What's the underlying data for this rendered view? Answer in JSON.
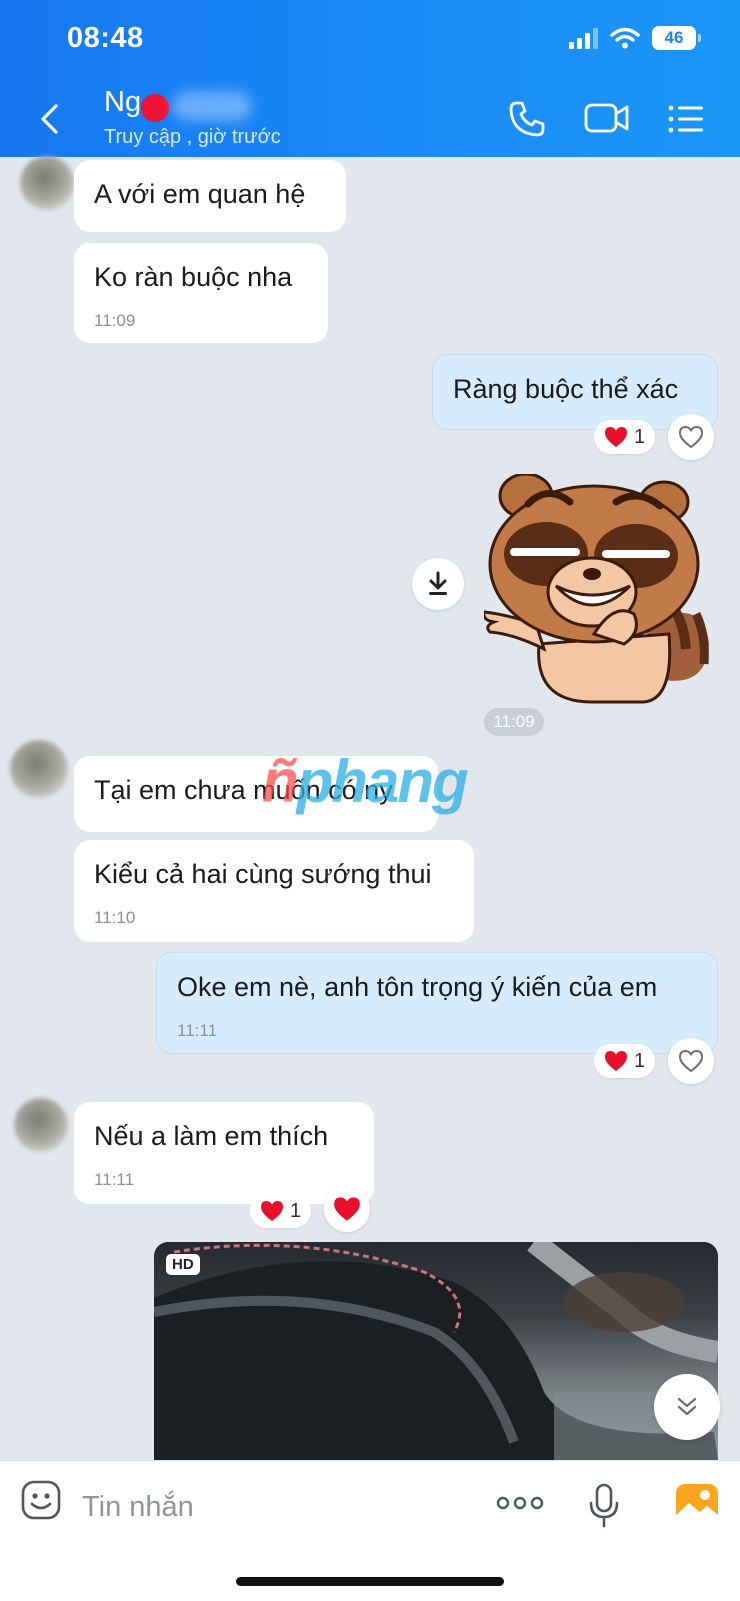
{
  "status_bar": {
    "time": "08:48",
    "battery": "46"
  },
  "header": {
    "contact_name": "Ng",
    "contact_status": "Truy cập , giờ trước",
    "icons": [
      "back-arrow-icon",
      "phone-icon",
      "video-call-icon",
      "menu-list-icon"
    ]
  },
  "messages": [
    {
      "sender": "them",
      "text": "A với em quan hệ"
    },
    {
      "sender": "them",
      "text": "Ko ràn buộc nha",
      "time": "11:09"
    },
    {
      "sender": "me",
      "text": "Ràng buộc thể xác",
      "reaction_count": "1"
    },
    {
      "sender": "me",
      "type": "sticker",
      "sticker": "raccoon-sticker"
    },
    {
      "sender": "them",
      "text": "Tại em chưa muốn có ny"
    },
    {
      "sender": "them",
      "text": "Kiểu cả hai cùng sướng thui",
      "time": "11:10"
    },
    {
      "sender": "me",
      "text": "Oke em nè, anh tôn trọng ý kiến của em",
      "time": "11:11",
      "reaction_count": "1"
    },
    {
      "sender": "them",
      "text": "Nếu a làm em thích",
      "time": "11:11",
      "reaction_count": "1"
    },
    {
      "sender": "them",
      "type": "video",
      "badge": "HD"
    }
  ],
  "center_time": "11:09",
  "watermark": {
    "part_a": "ñ",
    "part_b": "phang"
  },
  "input": {
    "placeholder": "Tin nhắn"
  },
  "colors": {
    "header": "#1a86f5",
    "my_bubble": "#d6ecfc",
    "heart": "#e8102a",
    "background": "#e2e7ee"
  }
}
